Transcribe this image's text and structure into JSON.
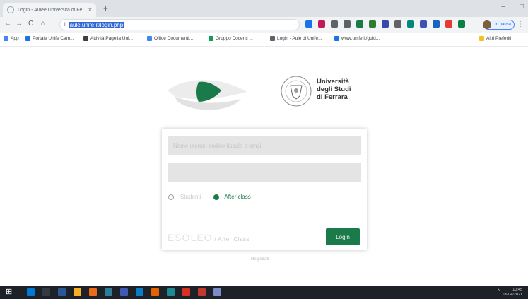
{
  "browser": {
    "tab_title": "Login - Aulee Universita di Fe",
    "tab_close": "×",
    "new_tab": "+",
    "window_controls": [
      "–",
      "□"
    ],
    "nav": {
      "back": "←",
      "forward": "→",
      "reload": "C",
      "home": "⌂"
    },
    "lock": "i",
    "url": "aule.unife.it/login.php",
    "profile_label": "In pausa",
    "menu": "⋮",
    "extension_colors": [
      "#1a73e8",
      "#c2185b",
      "#5f6368",
      "#5f6368",
      "#1b7a4a",
      "#2e7d32",
      "#3949ab",
      "#5f6368",
      "#00897b",
      "#3f51b5",
      "#1565c0",
      "#e53935",
      "#0b8043"
    ],
    "bookmarks": [
      {
        "label": "App",
        "color": "#4285f4"
      },
      {
        "label": "Portale Unife Cam...",
        "color": "#1a73e8"
      },
      {
        "label": "Attività Pagella Uni...",
        "color": "#3c4043"
      },
      {
        "label": "Office Documenti...",
        "color": "#4285f4"
      },
      {
        "label": "Gruppo Docenti ...",
        "color": "#0f9d58"
      },
      {
        "label": "Login - Aule di Unife...",
        "color": "#5f6368"
      },
      {
        "label": "www.unife.it/guid...",
        "color": "#1a73e8"
      }
    ],
    "other_bookmarks": "Altri Preferiti"
  },
  "page": {
    "university_name": [
      "Università",
      "degli Studi",
      "di Ferrara"
    ],
    "username_placeholder": "Nome utente, codice fiscale o email",
    "password_placeholder": "",
    "radio_options": [
      "Studenti",
      "After class"
    ],
    "selected_option": "After class",
    "brand_name": "ESOLEO",
    "brand_sub": " / After Class",
    "login_label": "Login",
    "footer": "Registrati"
  },
  "taskbar": {
    "start": "⊞",
    "apps": [
      {
        "color": "#0078d7"
      },
      {
        "color": "#333a44"
      },
      {
        "color": "#2b5797"
      },
      {
        "color": "#f8b124"
      },
      {
        "color": "#eb6c1a"
      },
      {
        "color": "#2d7d9a"
      },
      {
        "color": "#3f5ab6"
      },
      {
        "color": "#0a7cc8"
      },
      {
        "color": "#e66100"
      },
      {
        "color": "#1b8a91"
      },
      {
        "color": "#d93025"
      },
      {
        "color": "#c0392b"
      },
      {
        "color": "#7c8cc5"
      }
    ],
    "time": "10:45",
    "date": "06/04/2021"
  },
  "colors": {
    "accent_green": "#1b7a4a",
    "field_gray": "#e4e4e4"
  }
}
